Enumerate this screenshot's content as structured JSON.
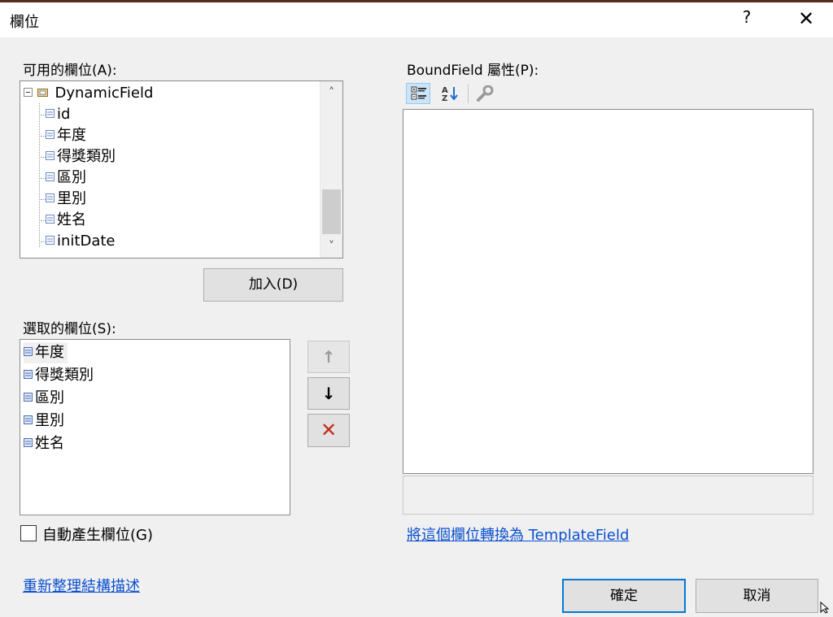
{
  "window": {
    "title": "欄位",
    "help": "?",
    "close": "✕"
  },
  "available": {
    "label": "可用的欄位(A):",
    "root": "DynamicField",
    "items": [
      "id",
      "年度",
      "得獎類別",
      "區別",
      "里別",
      "姓名",
      "initDate"
    ],
    "scroll_up": "˄",
    "scroll_down": "˅"
  },
  "add_button": "加入(D)",
  "selected": {
    "label": "選取的欄位(S):",
    "items": [
      "年度",
      "得獎類別",
      "區別",
      "里別",
      "姓名"
    ]
  },
  "move_up": "↑",
  "move_down": "↓",
  "delete": "✕",
  "auto_generate": {
    "label": "自動產生欄位(G)",
    "checked": false
  },
  "properties": {
    "label": "BoundField 屬性(P):"
  },
  "convert_link": "將這個欄位轉換為 TemplateField",
  "refresh_link": "重新整理結構描述",
  "ok_button": "確定",
  "cancel_button": "取消",
  "colors": {
    "link": "#0a4fd0",
    "accent": "#0078d7",
    "delete": "#c42b1c"
  },
  "icons": [
    "categorized-icon",
    "alphabetical-icon",
    "property-pages-icon",
    "field-icon",
    "move-up-icon",
    "move-down-icon",
    "delete-icon"
  ]
}
